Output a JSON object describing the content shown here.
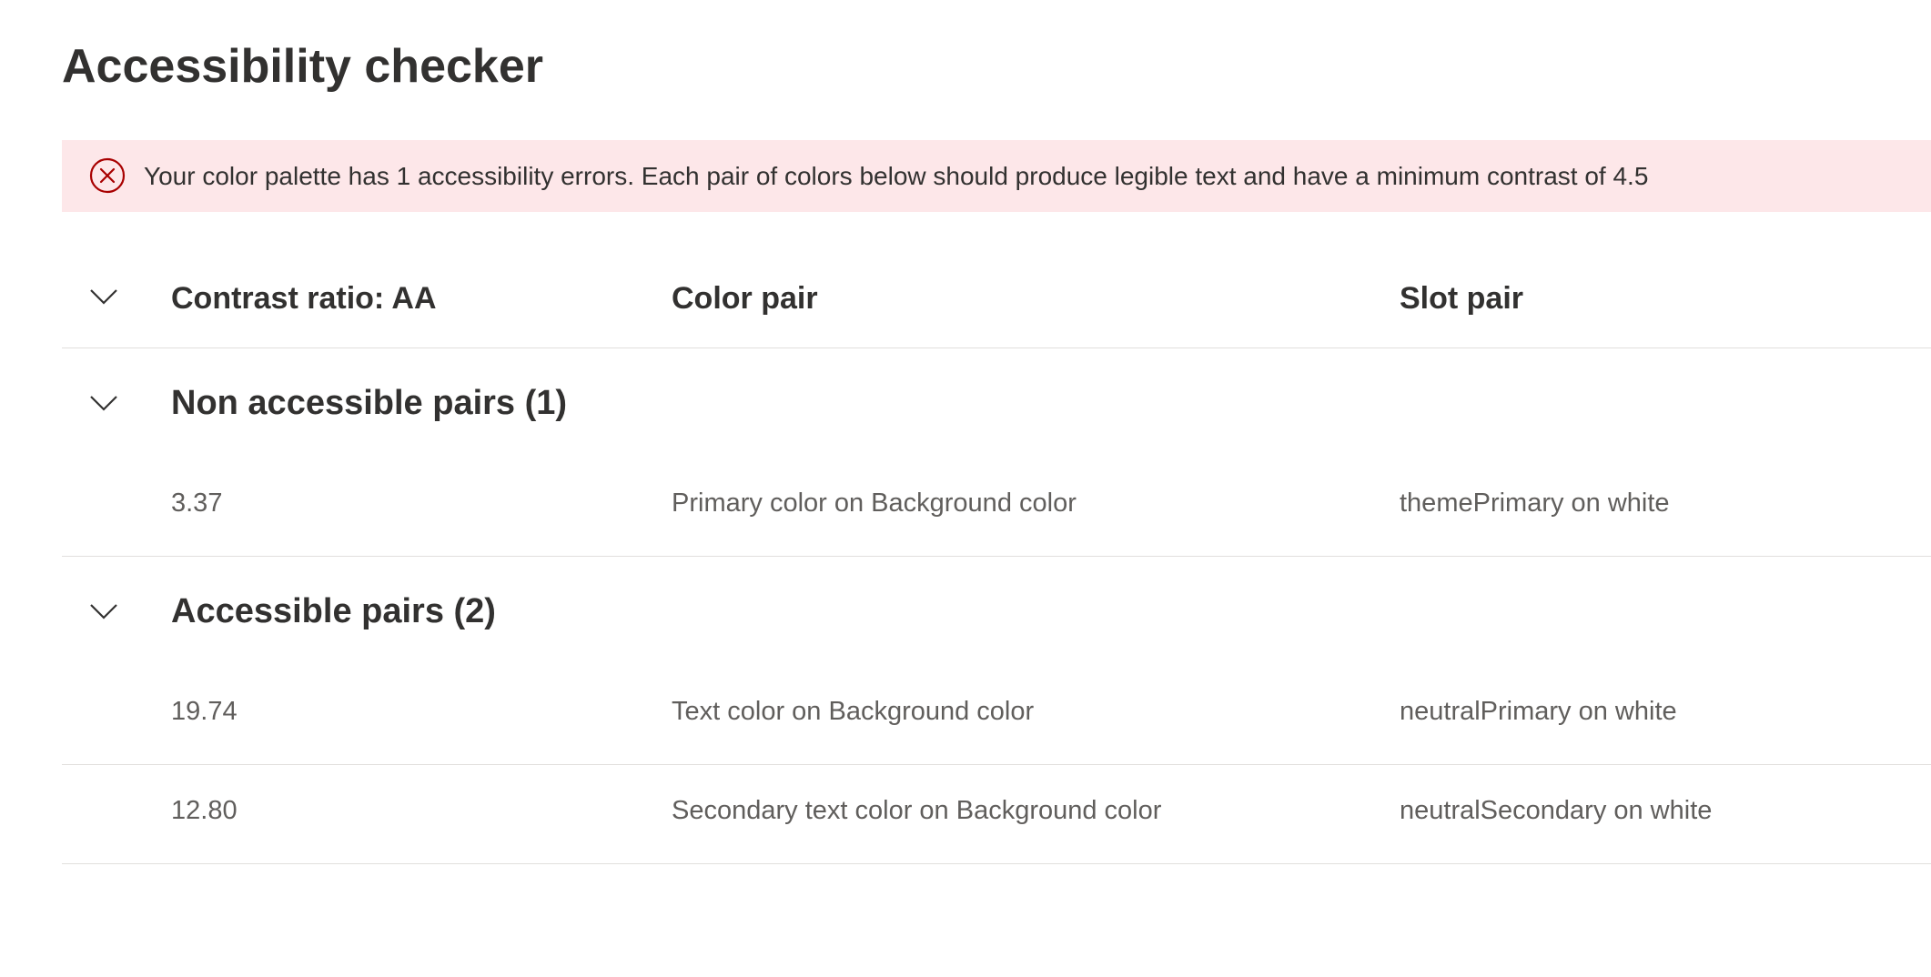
{
  "page": {
    "title": "Accessibility checker"
  },
  "error_bar": {
    "icon": "error-circle-icon",
    "message": "Your color palette has 1 accessibility errors. Each pair of colors below should produce legible text and have a minimum contrast of 4.5",
    "background_color": "#fde7e9",
    "icon_color": "#a80000"
  },
  "table": {
    "headers": {
      "contrast": "Contrast ratio: AA",
      "color_pair": "Color pair",
      "slot_pair": "Slot pair"
    },
    "groups": [
      {
        "title": "Non accessible pairs (1)",
        "rows": [
          {
            "contrast": "3.37",
            "color_pair": "Primary color on Background color",
            "slot_pair": "themePrimary on white"
          }
        ]
      },
      {
        "title": "Accessible pairs (2)",
        "rows": [
          {
            "contrast": "19.74",
            "color_pair": "Text color on Background color",
            "slot_pair": "neutralPrimary on white"
          },
          {
            "contrast": "12.80",
            "color_pair": "Secondary text color on Background color",
            "slot_pair": "neutralSecondary on white"
          }
        ]
      }
    ]
  }
}
